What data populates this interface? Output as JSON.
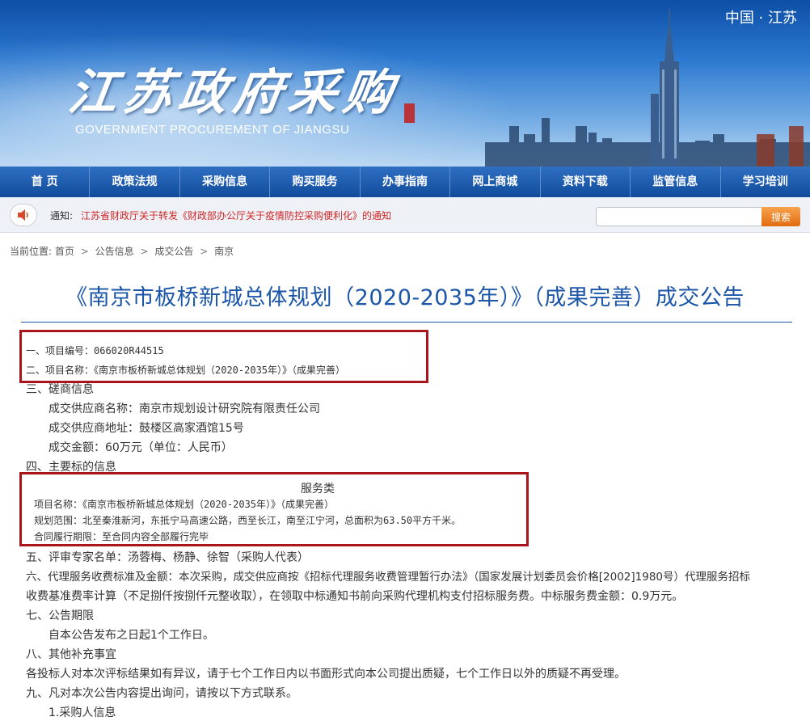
{
  "header": {
    "calligraphy": "江苏政府采购",
    "english": "GOVERNMENT PROCUREMENT OF JIANGSU",
    "region": "中国 · 江苏"
  },
  "nav": {
    "items": [
      "首 页",
      "政策法规",
      "采购信息",
      "购买服务",
      "办事指南",
      "网上商城",
      "资料下载",
      "监管信息",
      "学习培训"
    ]
  },
  "notice": {
    "label": "通知:",
    "link": "江苏省财政厅关于转发《财政部办公厅关于疫情防控采购便利化》的通知",
    "search_placeholder": "",
    "search_button": "搜索"
  },
  "breadcrumb": {
    "prefix": "当前位置:",
    "items": [
      "首页",
      "公告信息",
      "成交公告",
      "南京"
    ],
    "separator": ">"
  },
  "article": {
    "title": "《南京市板桥新城总体规划（2020-2035年）》（成果完善）成交公告",
    "project_no": "一、项目编号：066020R44515",
    "project_name": "二、项目名称：《南京市板桥新城总体规划（2020-2035年）》（成果完善）",
    "section3": "三、磋商信息",
    "supplier_name": "成交供应商名称：南京市规划设计研究院有限责任公司",
    "supplier_address": "成交供应商地址：鼓楼区高家酒馆15号",
    "amount": "成交金额：60万元（单位：人民币）",
    "section4": "四、主要标的信息",
    "service_header": "服务类",
    "service_name": "项目名称：《南京市板桥新城总体规划（2020-2035年）》（成果完善）",
    "service_scope": "规划范围：北至秦淮新河，东抵宁马高速公路，西至长江，南至江宁河，总面积为63.50平方千米。",
    "service_term": "合同履行期限：至合同内容全部履行完毕",
    "section5": "五、评审专家名单：汤蓉梅、杨静、徐智（采购人代表）",
    "section6_a": "六、代理服务收费标准及金额：本次采购，成交供应商按《招标代理服务收费管理暂行办法》（国家发展计划委员会价格[2002]1980号）代理服务招标",
    "section6_b": "收费基准费率计算（不足捌仟按捌仟元整收取），在领取中标通知书前向采购代理机构支付招标服务费。中标服务费金额：0.9万元。",
    "section7": "七、公告期限",
    "section7_detail": "自本公告发布之日起1个工作日。",
    "section8": "八、其他补充事宜",
    "section8_detail": "各投标人对本次评标结果如有异议，请于七个工作日内以书面形式向本公司提出质疑，七个工作日以外的质疑不再受理。",
    "section9": "九、凡对本次公告内容提出询问，请按以下方式联系。",
    "section9_item1": "1.采购人信息"
  },
  "colors": {
    "title_blue": "#1c56a8",
    "nav_blue": "#114c9c",
    "notice_red": "#d12626",
    "highlight_box": "#a8161b",
    "search_orange": "#e36b10"
  }
}
